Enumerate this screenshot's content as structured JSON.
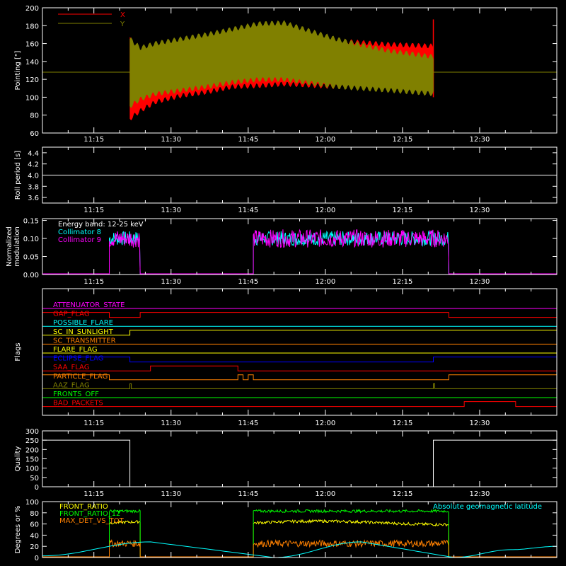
{
  "chart_data": [
    {
      "id": "pointing",
      "type": "line",
      "ylabel": "Pointing [\"]",
      "ylim": [
        60,
        200
      ],
      "yticks": [
        60,
        80,
        100,
        120,
        140,
        160,
        180,
        200
      ],
      "xlim": [
        "11:05",
        "12:45"
      ],
      "xticks": [
        "11:15",
        "11:30",
        "11:45",
        "12:00",
        "12:15",
        "12:30"
      ],
      "legend": [
        "X",
        "Y"
      ],
      "legend_position": "top-left",
      "series": [
        {
          "name": "X",
          "color": "#ff0000",
          "data_start": "11:22",
          "data_end": "12:21",
          "upper": [
            [
              0,
              167
            ],
            [
              2,
              135
            ],
            [
              5,
              150
            ],
            [
              10,
              157
            ],
            [
              15,
              163
            ],
            [
              20,
              170
            ],
            [
              25,
              174
            ],
            [
              30,
              173
            ],
            [
              40,
              163
            ],
            [
              50,
              159
            ],
            [
              59,
              157
            ]
          ],
          "lower": [
            [
              0,
              76
            ],
            [
              2,
              85
            ],
            [
              5,
              95
            ],
            [
              10,
              102
            ],
            [
              15,
              106
            ],
            [
              20,
              112
            ],
            [
              25,
              113
            ],
            [
              30,
              115
            ],
            [
              40,
              112
            ],
            [
              50,
              110
            ],
            [
              59,
              108
            ]
          ]
        },
        {
          "name": "Y",
          "color": "#808000",
          "data_start": "11:22",
          "data_end": "12:21",
          "upper": [
            [
              0,
              165
            ],
            [
              2,
              155
            ],
            [
              5,
              160
            ],
            [
              10,
              165
            ],
            [
              15,
              170
            ],
            [
              20,
              176
            ],
            [
              25,
              182
            ],
            [
              30,
              183
            ],
            [
              40,
              165
            ],
            [
              50,
              152
            ],
            [
              59,
              145
            ]
          ],
          "lower": [
            [
              0,
              90
            ],
            [
              2,
              98
            ],
            [
              5,
              104
            ],
            [
              10,
              108
            ],
            [
              15,
              112
            ],
            [
              20,
              117
            ],
            [
              25,
              120
            ],
            [
              30,
              120
            ],
            [
              40,
              112
            ],
            [
              50,
              108
            ],
            [
              59,
              104
            ]
          ]
        },
        {
          "name": "reference",
          "color": "#808000",
          "constant": 128
        }
      ]
    },
    {
      "id": "roll",
      "type": "line",
      "ylabel": "Roll period [s]",
      "ylim": [
        3.5,
        4.5
      ],
      "yticks": [
        "3.6",
        "3.8",
        "4.0",
        "4.2",
        "4.4"
      ],
      "xticks": [
        "11:15",
        "11:30",
        "11:45",
        "12:00",
        "12:15",
        "12:30"
      ],
      "series": [
        {
          "name": "",
          "color": "#ffffff",
          "constant": 4.0
        }
      ]
    },
    {
      "id": "modulation",
      "type": "line",
      "ylabel": "Normalized modulation",
      "ylim": [
        0,
        0.155
      ],
      "yticks": [
        "0.00",
        "0.05",
        "0.10",
        "0.15"
      ],
      "xticks": [
        "11:15",
        "11:30",
        "11:45",
        "12:00",
        "12:15",
        "12:30"
      ],
      "legend": [
        "Energy band: 12-25 keV",
        "Collimator 8",
        "Collimator 9"
      ],
      "legend_colors": [
        "#ffffff",
        "#00ffff",
        "#ff00ff"
      ],
      "legend_position": "top-left",
      "intervals": [
        [
          "11:18",
          "11:24"
        ],
        [
          "11:46",
          "12:24"
        ]
      ],
      "series": [
        {
          "name": "Collimator 8",
          "color": "#00ffff",
          "mean": 0.1,
          "spread": 0.02
        },
        {
          "name": "Collimator 9",
          "color": "#ff00ff",
          "mean": 0.1,
          "spread": 0.025
        }
      ]
    },
    {
      "id": "flags",
      "type": "line",
      "ylabel": "Flags",
      "xticks": [
        "11:15",
        "11:30",
        "11:45",
        "12:00",
        "12:15",
        "12:30"
      ],
      "flags": [
        {
          "name": "ATTENUATOR_STATE",
          "color": "#ff00ff",
          "pulses": []
        },
        {
          "name": "SAA_FLAG",
          "color": "#ff0000",
          "pulses": [
            [
              "11:05",
              "11:18"
            ],
            [
              "11:24",
              "12:24"
            ]
          ],
          "display": "GAP_FLAG"
        },
        {
          "name": "POSSIBLE_FLARE",
          "color": "#00ffff",
          "pulses": []
        },
        {
          "name": "SC_IN_SUNLIGHT",
          "color": "#ffff00",
          "pulses": [
            [
              "11:22",
              "12:45"
            ]
          ]
        },
        {
          "name": "SC_TRANSMITTER",
          "color": "#ff8000",
          "pulses": []
        },
        {
          "name": "FLARE_FLAG",
          "color": "#ffff00",
          "pulses": []
        },
        {
          "name": "ECLIPSE_FLAG",
          "color": "#0000ff",
          "pulses": [
            [
              "11:05",
              "11:22"
            ],
            [
              "12:21",
              "12:45"
            ]
          ]
        },
        {
          "name": "SAA_FLAG",
          "color": "#ff0000",
          "pulses": [
            [
              "11:26",
              "11:43"
            ]
          ]
        },
        {
          "name": "PARTICLE_FLAG",
          "color": "#ff8000",
          "pulses": [
            [
              "11:05",
              "11:18"
            ],
            [
              "11:43",
              "11:44"
            ],
            [
              "11:45",
              "11:46"
            ],
            [
              "12:24",
              "12:45"
            ]
          ]
        },
        {
          "name": "AAZ_FLAG",
          "color": "#808000",
          "pulses": [
            [
              "11:22",
              "11:22"
            ],
            [
              "12:21",
              "12:21"
            ]
          ]
        },
        {
          "name": "FRONTS_OFF",
          "color": "#00ff00",
          "pulses": []
        },
        {
          "name": "BAD_PACKETS",
          "color": "#ff0000",
          "pulses": [
            [
              "12:27",
              "12:37"
            ]
          ]
        }
      ]
    },
    {
      "id": "quality",
      "type": "line",
      "ylabel": "Quality",
      "ylim": [
        0,
        300
      ],
      "yticks": [
        0,
        50,
        100,
        150,
        200,
        250,
        300
      ],
      "xticks": [
        "11:15",
        "11:30",
        "11:45",
        "12:00",
        "12:15",
        "12:30"
      ],
      "series": [
        {
          "name": "",
          "color": "#ffffff",
          "steps": [
            [
              "11:05",
              250
            ],
            [
              "11:22",
              0
            ],
            [
              "12:21",
              250
            ],
            [
              "12:45",
              250
            ]
          ]
        }
      ]
    },
    {
      "id": "ratios",
      "type": "line",
      "ylabel": "Degrees or %",
      "ylim": [
        0,
        100
      ],
      "yticks": [
        0,
        20,
        40,
        60,
        80,
        100
      ],
      "legend": [
        "FRONT_RATIO",
        "FRONT_RATIO_12",
        "MAX_DET_VS_TOT"
      ],
      "legend_colors": [
        "#ffff00",
        "#00ff00",
        "#ff8000"
      ],
      "legend_position": "top-left",
      "right_label": "Absolute geomagnetic latitude",
      "intervals": [
        [
          "11:18",
          "11:24"
        ],
        [
          "11:46",
          "12:24"
        ]
      ],
      "series": [
        {
          "name": "FRONT_RATIO",
          "color": "#ffff00",
          "mean": 62
        },
        {
          "name": "FRONT_RATIO_12",
          "color": "#00ff00",
          "mean": 83
        },
        {
          "name": "MAX_DET_VS_TOT",
          "color": "#ff8000",
          "mean": 25
        },
        {
          "name": "Absolute geomagnetic latitude",
          "color": "#00ffff",
          "points": [
            [
              "11:05",
              3
            ],
            [
              "11:26",
              28
            ],
            [
              "11:50",
              0
            ],
            [
              "12:07",
              28
            ],
            [
              "12:25",
              0
            ],
            [
              "12:36",
              14
            ],
            [
              "12:45",
              20
            ]
          ]
        }
      ]
    }
  ]
}
